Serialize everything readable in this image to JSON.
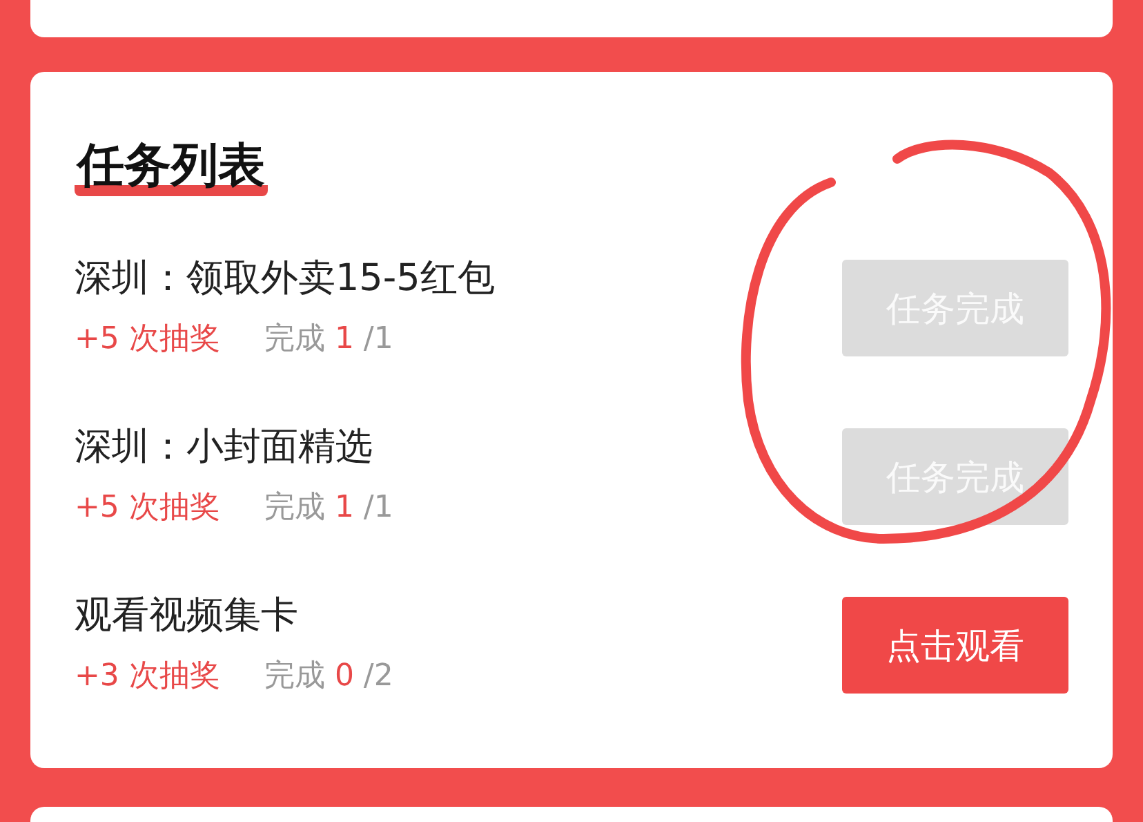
{
  "title": "任务列表",
  "tasks": [
    {
      "name": "深圳：领取外卖15-5红包",
      "reward": "+5 次抽奖",
      "progress_label": "完成",
      "done": "1",
      "total": "/1",
      "button": "任务完成",
      "completed": true
    },
    {
      "name": "深圳：小封面精选",
      "reward": "+5 次抽奖",
      "progress_label": "完成",
      "done": "1",
      "total": "/1",
      "button": "任务完成",
      "completed": true
    },
    {
      "name": "观看视频集卡",
      "reward": "+3 次抽奖",
      "progress_label": "完成",
      "done": "0",
      "total": "/2",
      "button": "点击观看",
      "completed": false
    }
  ]
}
